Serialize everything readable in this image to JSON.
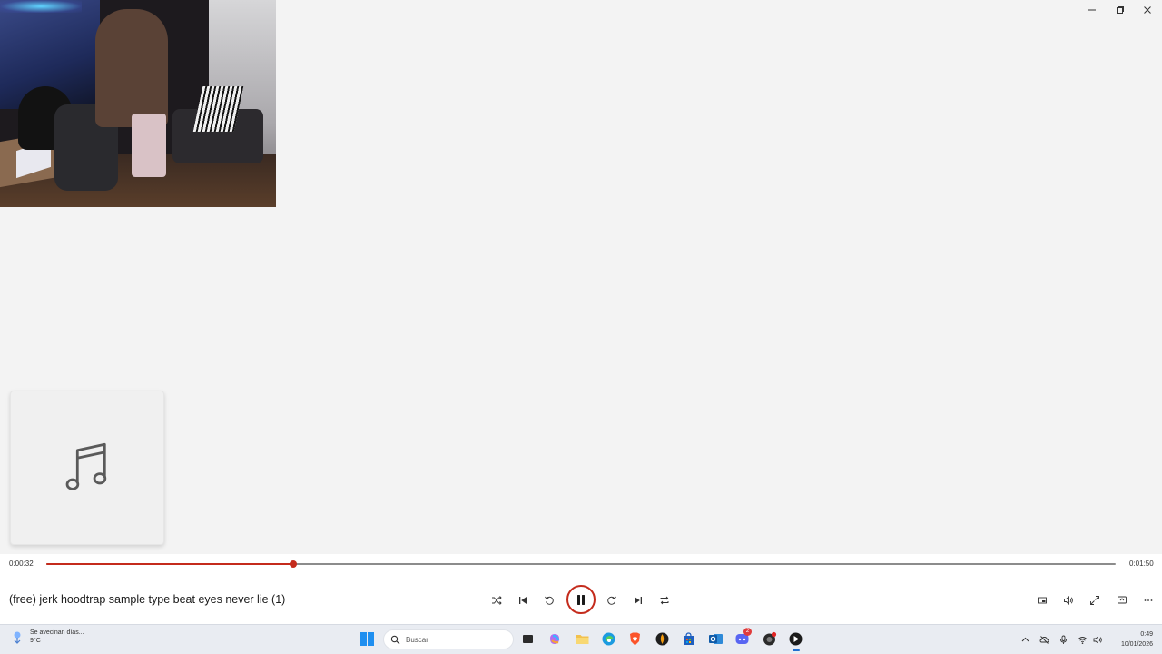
{
  "window": {
    "controls": {
      "minimize": "minimize-icon",
      "maximize": "restore-icon",
      "close": "close-icon"
    }
  },
  "webcam": {
    "description_icon": "webcam-overlay"
  },
  "album_art": {
    "icon": "music-note-icon"
  },
  "player": {
    "time_current": "0:00:32",
    "time_total": "0:01:50",
    "progress_fraction": 0.2313,
    "accent_color": "#c42b1c",
    "song_title": "(free) jerk  hoodtrap  sample type beat eyes never lie (1)",
    "controls": {
      "shuffle": "shuffle-icon",
      "previous": "previous-icon",
      "rewind": "rewind-10-icon",
      "play_pause": "pause-icon",
      "forward": "forward-30-icon",
      "next": "next-icon",
      "repeat": "repeat-icon",
      "miniplayer": "miniplayer-icon",
      "volume": "volume-icon",
      "fullscreen": "fullscreen-icon",
      "cast": "cast-icon",
      "more": "more-icon"
    }
  },
  "taskbar": {
    "weather_text": "Se avecinan días...",
    "weather_temp": "9°C",
    "search_placeholder": "Buscar",
    "clock_time": "0:49",
    "clock_date": "10/01/2026",
    "badge_count": "2"
  }
}
